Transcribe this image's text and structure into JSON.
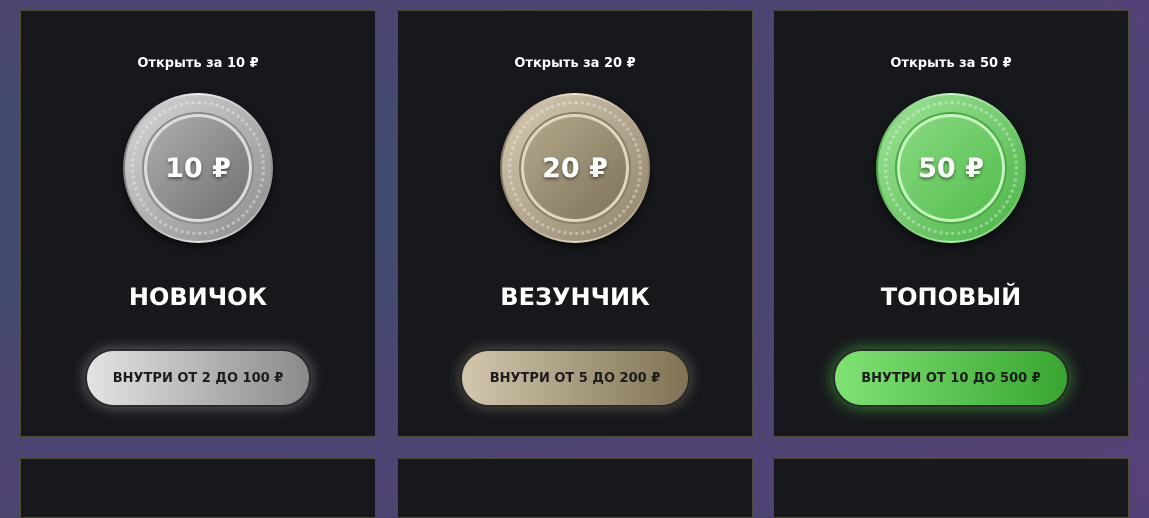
{
  "cases": [
    {
      "open_label": "Открыть за 10 ₽",
      "coin_value": "10 ₽",
      "name": "НОВИЧОК",
      "button_label": "ВНУТРИ ОТ 2 ДО 100 ₽",
      "color": "#9e9e9e"
    },
    {
      "open_label": "Открыть за 20 ₽",
      "coin_value": "20 ₽",
      "name": "ВЕЗУНЧИК",
      "button_label": "ВНУТРИ ОТ 5 ДО 200 ₽",
      "color": "#a89c80"
    },
    {
      "open_label": "Открыть за 50 ₽",
      "coin_value": "50 ₽",
      "name": "ТОПОВЫЙ",
      "button_label": "ВНУТРИ ОТ 10 ДО 500 ₽",
      "color": "#5cc653"
    }
  ],
  "colors": {
    "card_bg": "#17181c",
    "card_border": "#4f4a33",
    "page_bg": "#4a4670"
  }
}
